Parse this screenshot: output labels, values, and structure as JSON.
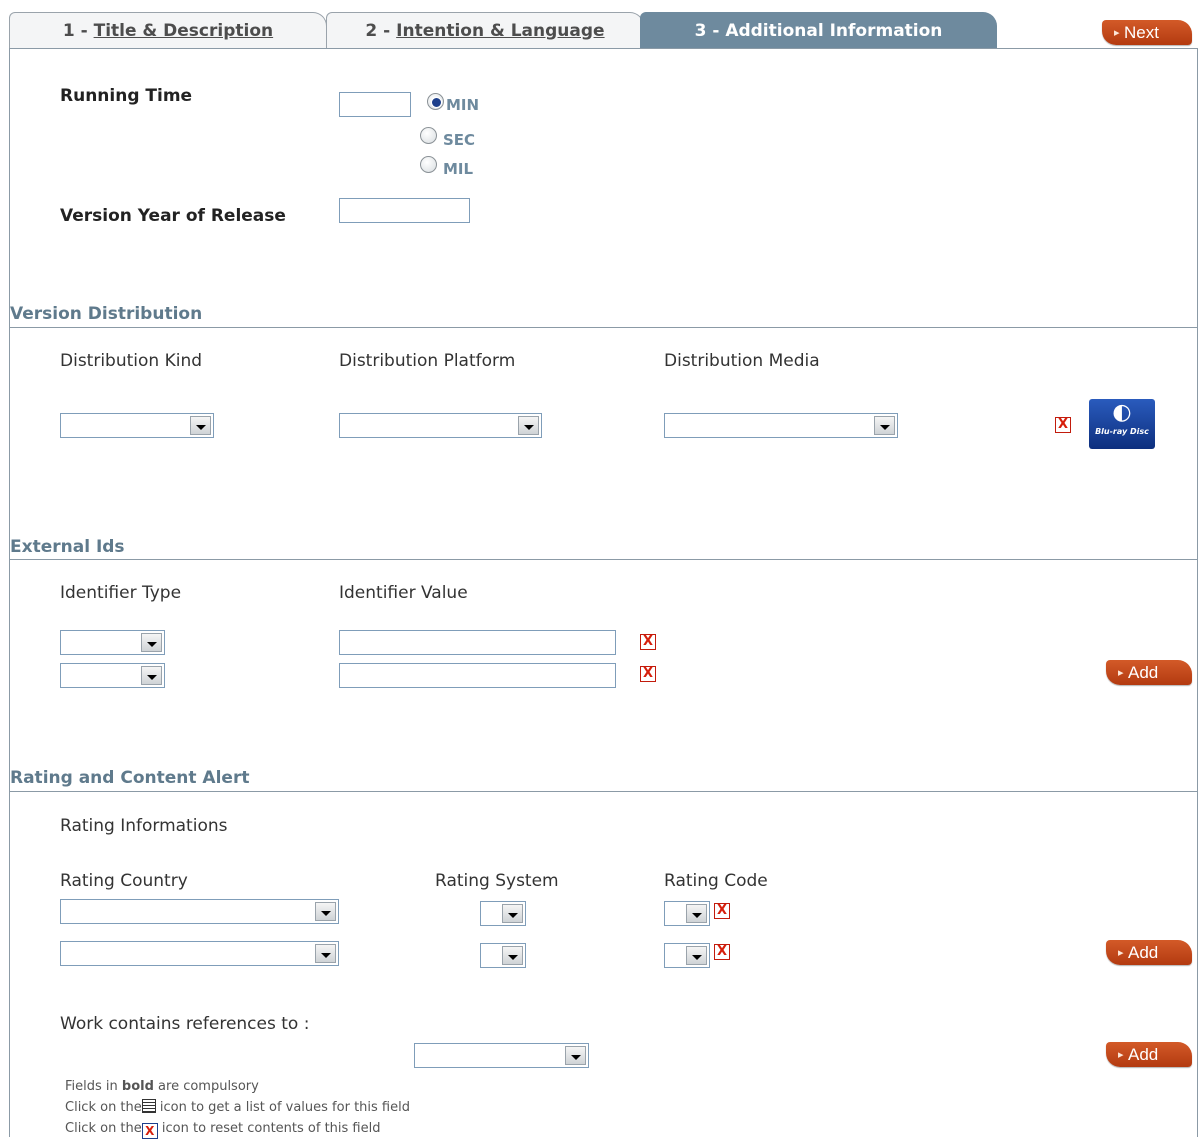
{
  "tabs": [
    {
      "num": "1 - ",
      "label": "Title & Description"
    },
    {
      "num": "2 - ",
      "label": "Intention & Language"
    },
    {
      "num": "3 - ",
      "label": "Additional Information"
    }
  ],
  "next_label": "Next",
  "running_time": {
    "label": "Running Time",
    "value": "",
    "units": [
      "MIN",
      "SEC",
      "MIL"
    ],
    "selected": "MIN"
  },
  "version_year": {
    "label": "Version Year of Release",
    "value": ""
  },
  "version_distribution": {
    "title": "Version Distribution",
    "kind_label": "Distribution Kind",
    "platform_label": "Distribution Platform",
    "media_label": "Distribution Media",
    "bluray_text": "Blu-ray Disc"
  },
  "external_ids": {
    "title": "External Ids",
    "type_label": "Identifier Type",
    "value_label": "Identifier Value",
    "add_label": "Add"
  },
  "rating": {
    "title": "Rating and Content Alert",
    "info_label": "Rating Informations",
    "country_label": "Rating Country",
    "system_label": "Rating System",
    "code_label": "Rating Code",
    "add_label": "Add",
    "references_label": "Work contains references to :",
    "references_add_label": "Add"
  },
  "footnotes": {
    "line1_pre": "Fields in ",
    "line1_bold": "bold",
    "line1_post": " are compulsory",
    "line2_pre": "Click on the",
    "line2_post": " icon to get a list of values for this field",
    "line3_pre": "Click on the",
    "line3_post": " icon to reset contents of this field"
  },
  "icons": {
    "reset": "X"
  }
}
